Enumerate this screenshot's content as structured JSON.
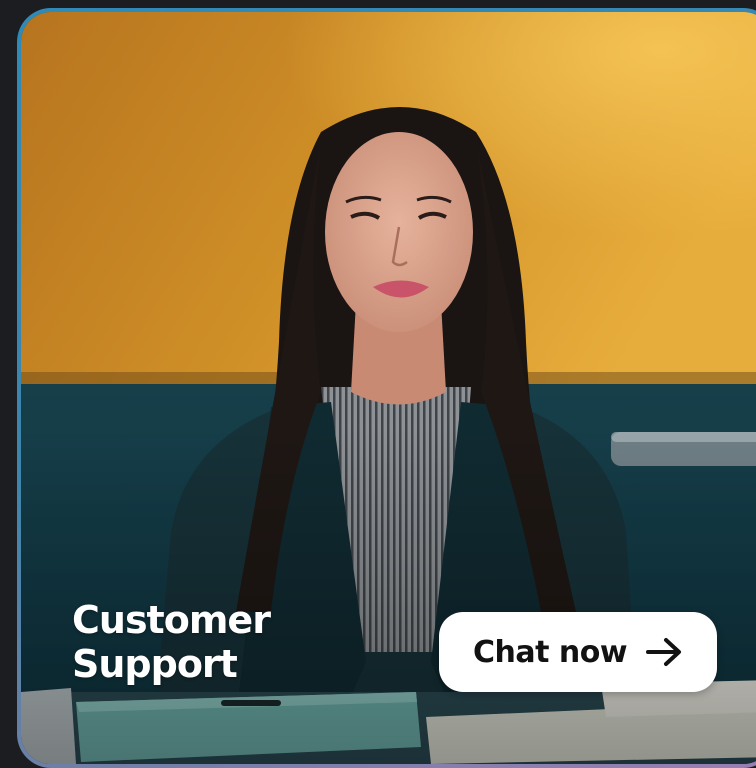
{
  "card": {
    "title_line1": "Customer",
    "title_line2": "Support",
    "button_label": "Chat now",
    "button_icon": "arrow-right-icon"
  },
  "colors": {
    "border": "#2f8ab8",
    "wall": "#d89a2a",
    "lower_wall": "#123c47",
    "button_bg": "#ffffff",
    "button_text": "#121212",
    "title_text": "#ffffff"
  }
}
